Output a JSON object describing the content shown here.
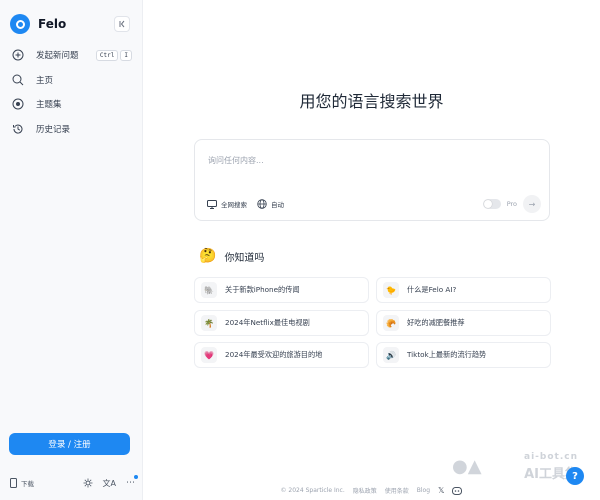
{
  "sidebar": {
    "brand": "Felo",
    "collapse_icon": "collapse-sidebar-icon",
    "items": [
      {
        "label": "发起新问题",
        "icon": "plus-circle-icon",
        "shortcut": [
          "Ctrl",
          "I"
        ]
      },
      {
        "label": "主页",
        "icon": "search-icon"
      },
      {
        "label": "主题集",
        "icon": "topic-collection-icon"
      },
      {
        "label": "历史记录",
        "icon": "history-icon"
      }
    ],
    "login_label": "登录 / 注册",
    "download_label": "下载"
  },
  "main": {
    "hero_title": "用您的语言搜索世界",
    "search": {
      "placeholder": "询问任何内容...",
      "source_label": "全网搜索",
      "language_label": "自动",
      "pro_label": "Pro"
    },
    "did_you_know": {
      "title": "你知道吗",
      "emoji": "🤔",
      "cards": [
        {
          "emoji": "🐘",
          "text": "关于新款iPhone的传闻"
        },
        {
          "emoji": "🐤",
          "text": "什么是Felo AI?"
        },
        {
          "emoji": "🌴",
          "text": "2024年Netflix最佳电视剧"
        },
        {
          "emoji": "🥐",
          "text": "好吃的减肥餐推荐"
        },
        {
          "emoji": "💗",
          "text": "2024年最受欢迎的旅游目的地"
        },
        {
          "emoji": "🔊",
          "text": "Tiktok上最新的流行趋势"
        }
      ]
    },
    "footer": {
      "copyright": "© 2024 Sparticle Inc.",
      "links": [
        "隐私政策",
        "使用条款",
        "Blog"
      ]
    }
  },
  "watermark": {
    "line1": "ai-bot.cn",
    "line2": "AI工具集"
  },
  "help_label": "?",
  "colors": {
    "accent": "#1e88f2",
    "sidebar_bg": "#f8f9fb"
  }
}
